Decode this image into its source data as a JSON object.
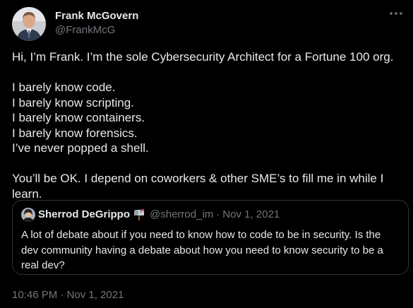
{
  "author": {
    "name": "Frank McGovern",
    "handle": "@FrankMcG"
  },
  "body_lines": [
    "Hi, I’m Frank. I’m the sole Cybersecurity Architect for a Fortune 100 org.",
    "",
    "I barely know code.",
    "I barely know scripting.",
    "I barely know containers.",
    "I barely know forensics.",
    "I’ve never popped a shell.",
    "",
    "You’ll be OK. I depend on coworkers & other SME’s to fill me in while I",
    "learn."
  ],
  "quoted": {
    "name": "Sherrod DeGrippo",
    "badge_icon": "mailbox-icon",
    "handle": "@sherrod_im",
    "separator": "·",
    "date": "Nov 1, 2021",
    "text_lines": [
      "A lot of debate about if you need to know how to code to be in security. Is the",
      "dev community having a debate about how you need to know security to be a",
      "real dev?"
    ]
  },
  "footer": {
    "time": "10:46 PM",
    "separator": "·",
    "date": "Nov 1, 2021"
  },
  "colors": {
    "background": "#000000",
    "text": "#e7e9ea",
    "muted": "#71767b",
    "border": "#2f3336"
  }
}
